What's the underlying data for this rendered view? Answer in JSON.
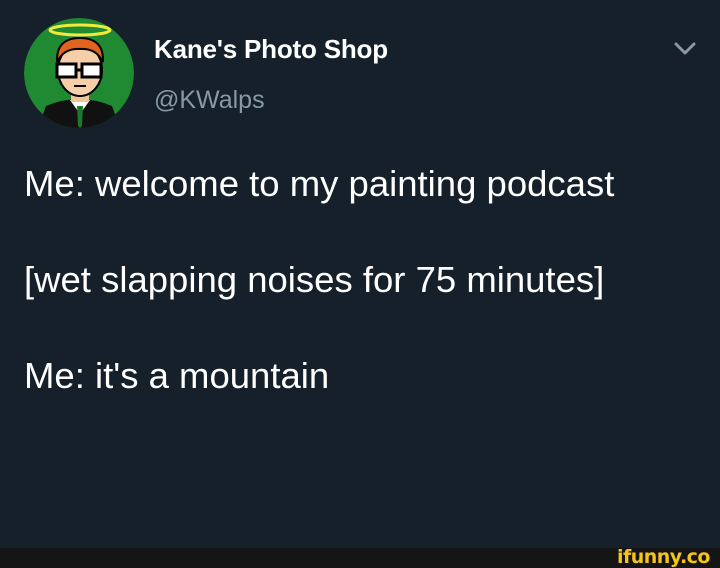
{
  "account": {
    "display_name": "Kane's Photo Shop",
    "handle": "@KWalps",
    "avatar_icon": "cartoon-man-with-halo-icon",
    "menu_icon": "chevron-down-icon"
  },
  "tweet": {
    "paragraphs": [
      "Me: welcome to my painting podcast",
      "[wet slapping noises for 75 minutes]",
      "Me: it's a mountain"
    ]
  },
  "watermark": {
    "text": "ifunny.co",
    "color": "#f5c518"
  },
  "colors": {
    "background": "#15202b",
    "secondary_text": "#8899a6",
    "avatar_bg": "#1f8a32"
  }
}
